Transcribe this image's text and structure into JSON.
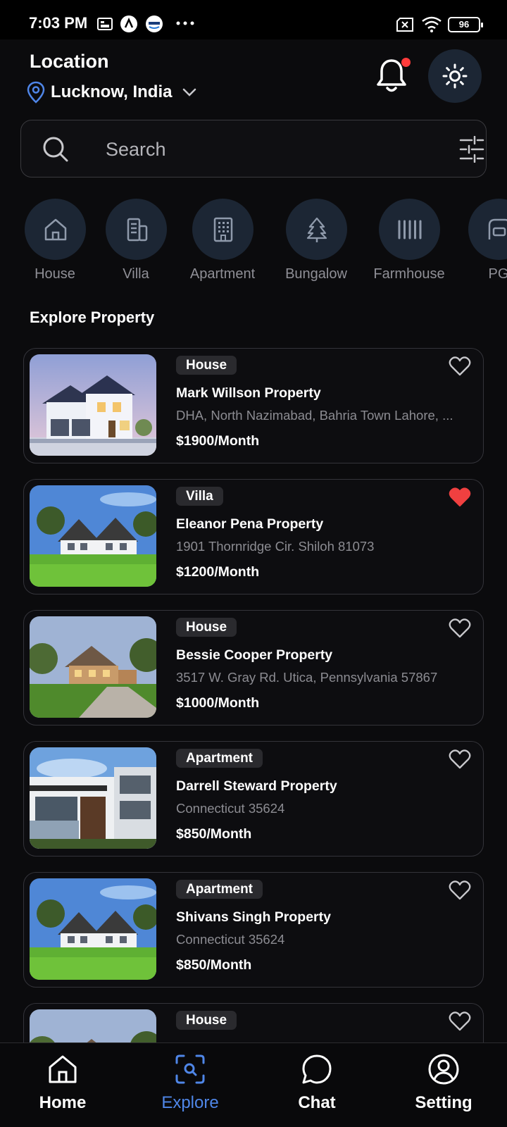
{
  "status_bar": {
    "time": "7:03 PM",
    "battery": "96"
  },
  "header": {
    "location_title": "Location",
    "location_value": "Lucknow, India"
  },
  "search": {
    "placeholder": "Search"
  },
  "categories": [
    {
      "label": "House",
      "icon": "house-icon"
    },
    {
      "label": "Villa",
      "icon": "villa-icon"
    },
    {
      "label": "Apartment",
      "icon": "apartment-icon"
    },
    {
      "label": "Bungalow",
      "icon": "tree-icon"
    },
    {
      "label": "Farmhouse",
      "icon": "fence-icon"
    },
    {
      "label": "PG",
      "icon": "pg-icon"
    }
  ],
  "explore": {
    "title": "Explore Property",
    "properties": [
      {
        "tag": "House",
        "title": "Mark Willson Property",
        "address": "DHA, North Nazimabad, Bahria Town Lahore, ...",
        "price": "$1900/Month",
        "favorite": false
      },
      {
        "tag": "Villa",
        "title": "Eleanor Pena Property",
        "address": "1901 Thornridge Cir. Shiloh 81073",
        "price": "$1200/Month",
        "favorite": true
      },
      {
        "tag": "House",
        "title": "Bessie Cooper Property",
        "address": "3517 W. Gray Rd. Utica, Pennsylvania 57867",
        "price": "$1000/Month",
        "favorite": false
      },
      {
        "tag": "Apartment",
        "title": "Darrell Steward Property",
        "address": "Connecticut 35624",
        "price": "$850/Month",
        "favorite": false
      },
      {
        "tag": "Apartment",
        "title": "Shivans Singh Property",
        "address": "Connecticut 35624",
        "price": "$850/Month",
        "favorite": false
      },
      {
        "tag": "House",
        "title": "",
        "address": "",
        "price": "",
        "favorite": false
      }
    ]
  },
  "bottom_nav": [
    {
      "label": "Home",
      "icon": "home-icon",
      "active": false
    },
    {
      "label": "Explore",
      "icon": "explore-scan-icon",
      "active": true
    },
    {
      "label": "Chat",
      "icon": "chat-icon",
      "active": false
    },
    {
      "label": "Setting",
      "icon": "user-icon",
      "active": false
    }
  ],
  "colors": {
    "accent": "#4f86e8",
    "background": "#0b0b0d",
    "category_bg": "#1c2634",
    "favorite": "#f04040"
  }
}
